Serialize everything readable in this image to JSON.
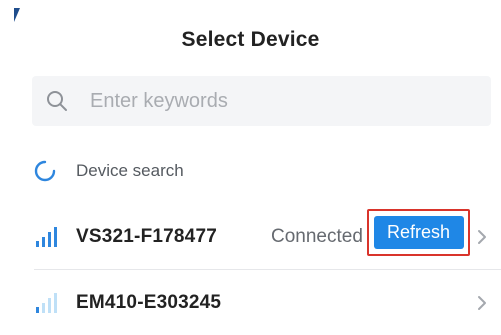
{
  "header": {
    "title": "Select Device"
  },
  "search": {
    "placeholder": "Enter keywords",
    "value": ""
  },
  "search_status": {
    "label": "Device search",
    "icon": "spinner-icon"
  },
  "devices": [
    {
      "name": "VS321-F178477",
      "status": "Connected",
      "action_label": "Refresh",
      "signal_icon": "signal-strength-icon",
      "highlighted": true
    },
    {
      "name": "EM410-E303245",
      "status": "",
      "signal_icon": "signal-strength-icon"
    }
  ],
  "colors": {
    "accent": "#1f87e6",
    "highlight_border": "#d9342b",
    "signal_strong": "#2e86de",
    "signal_weak": "#bfe0f7",
    "divider": "#e6e7ea"
  }
}
